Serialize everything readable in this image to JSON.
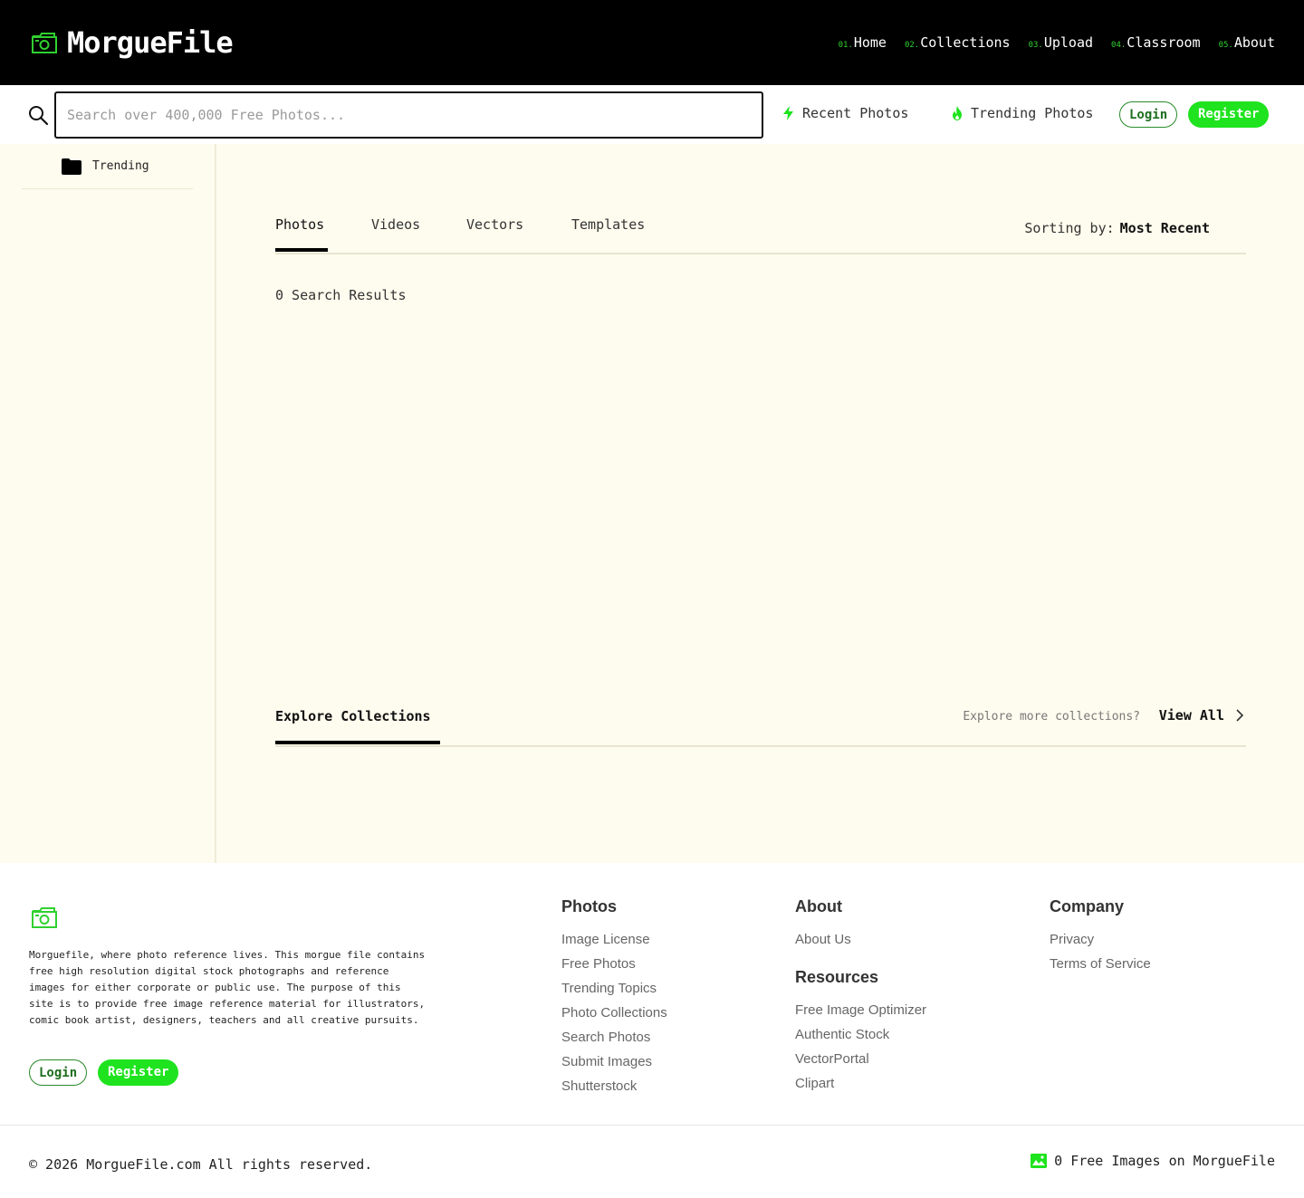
{
  "brand": {
    "name": "MorgueFile"
  },
  "nav": [
    {
      "num": "01.",
      "label": "Home"
    },
    {
      "num": "02.",
      "label": "Collections"
    },
    {
      "num": "03.",
      "label": "Upload"
    },
    {
      "num": "04.",
      "label": "Classroom"
    },
    {
      "num": "05.",
      "label": "About"
    }
  ],
  "search": {
    "placeholder": "Search over 400,000 Free Photos..."
  },
  "quick_links": {
    "recent": "Recent Photos",
    "trending": "Trending Photos"
  },
  "auth": {
    "login": "Login",
    "register": "Register"
  },
  "sidebar": {
    "items": [
      {
        "label": "Trending"
      }
    ]
  },
  "tabs": [
    "Photos",
    "Videos",
    "Vectors",
    "Templates"
  ],
  "sorting": {
    "label": "Sorting by:",
    "value": "Most Recent"
  },
  "results": {
    "text": "0 Search Results"
  },
  "explore": {
    "title": "Explore Collections",
    "more": "Explore more collections?",
    "view_all": "View All"
  },
  "footer": {
    "description": "Morguefile, where photo reference lives. This morgue file contains free high resolution digital stock photographs and reference images for either corporate or public use. The purpose of this site is to provide free image reference material for illustrators, comic book artist, designers, teachers and all creative pursuits.",
    "photos": {
      "heading": "Photos",
      "links": [
        "Image License",
        "Free Photos",
        "Trending Topics",
        "Photo Collections",
        "Search Photos",
        "Submit Images",
        "Shutterstock"
      ]
    },
    "about": {
      "heading": "About",
      "links": [
        "About Us"
      ]
    },
    "resources": {
      "heading": "Resources",
      "links": [
        "Free Image Optimizer",
        "Authentic Stock",
        "VectorPortal",
        "Clipart"
      ]
    },
    "company": {
      "heading": "Company",
      "links": [
        "Privacy",
        "Terms of Service"
      ]
    },
    "copyright": "© 2026 MorgueFile.com All rights reserved.",
    "image_count": "0 Free Images on MorgueFile"
  },
  "colors": {
    "accent": "#1ee31e",
    "header_bg": "#000000",
    "main_bg": "#fefcee"
  }
}
